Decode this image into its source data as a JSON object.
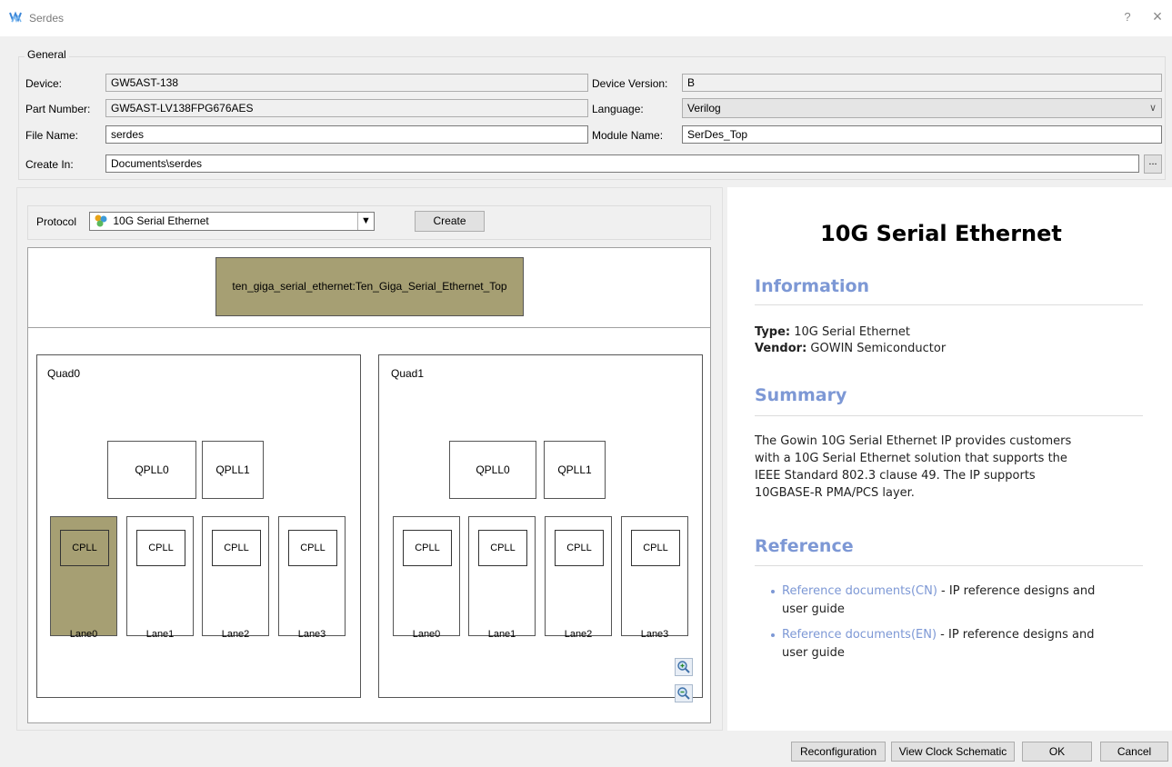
{
  "window": {
    "title": "Serdes",
    "help_glyph": "?",
    "close_glyph": "×",
    "icon": "gowin-logo-icon"
  },
  "general": {
    "group_title": "General",
    "device_label": "Device:",
    "device_value": "GW5AST-138",
    "device_version_label": "Device Version:",
    "device_version_value": "B",
    "part_number_label": "Part Number:",
    "part_number_value": "GW5AST-LV138FPG676AES",
    "language_label": "Language:",
    "language_value": "Verilog",
    "file_name_label": "File Name:",
    "file_name_value": "serdes",
    "module_name_label": "Module Name:",
    "module_name_value": "SerDes_Top",
    "create_in_label": "Create In:",
    "create_in_value": "Documents\\serdes",
    "browse_label": "..."
  },
  "protocol": {
    "label": "Protocol",
    "selected": "10G Serial Ethernet",
    "create_label": "Create"
  },
  "schematic": {
    "top_module": "ten_giga_serial_ethernet:Ten_Giga_Serial_Ethernet_Top",
    "quads": [
      {
        "name": "Quad0",
        "plls": [
          "QPLL0",
          "QPLL1"
        ],
        "lanes": [
          {
            "name": "Lane0",
            "cpll": "CPLL",
            "selected": true
          },
          {
            "name": "Lane1",
            "cpll": "CPLL",
            "selected": false
          },
          {
            "name": "Lane2",
            "cpll": "CPLL",
            "selected": false
          },
          {
            "name": "Lane3",
            "cpll": "CPLL",
            "selected": false
          }
        ]
      },
      {
        "name": "Quad1",
        "plls": [
          "QPLL0",
          "QPLL1"
        ],
        "lanes": [
          {
            "name": "Lane0",
            "cpll": "CPLL",
            "selected": false
          },
          {
            "name": "Lane1",
            "cpll": "CPLL",
            "selected": false
          },
          {
            "name": "Lane2",
            "cpll": "CPLL",
            "selected": false
          },
          {
            "name": "Lane3",
            "cpll": "CPLL",
            "selected": false
          }
        ]
      }
    ],
    "zoom_in_icon": "zoom-in-icon",
    "zoom_out_icon": "zoom-out-icon"
  },
  "doc": {
    "title": "10G Serial Ethernet",
    "information_heading": "Information",
    "type_label": "Type:",
    "type_value": " 10G Serial Ethernet",
    "vendor_label": "Vendor:",
    "vendor_value": " GOWIN Semiconductor",
    "summary_heading": "Summary",
    "summary_lines": [
      "The Gowin 10G Serial Ethernet IP provides customers",
      "with a 10G Serial Ethernet solution that supports the",
      "IEEE Standard 802.3 clause 49. The IP supports",
      "10GBASE-R PMA/PCS layer."
    ],
    "reference_heading": "Reference",
    "references": [
      {
        "link": "Reference documents(CN)",
        "text": " - IP reference designs and",
        "text2": "user guide"
      },
      {
        "link": "Reference documents(EN)",
        "text": " - IP reference designs and",
        "text2": "user guide"
      }
    ]
  },
  "buttons": {
    "reconfiguration": "Reconfiguration",
    "view_clock": "View Clock Schematic",
    "ok": "OK",
    "cancel": "Cancel"
  },
  "colors": {
    "selected_block": "#a69f73",
    "heading_accent": "#7d98d5"
  }
}
